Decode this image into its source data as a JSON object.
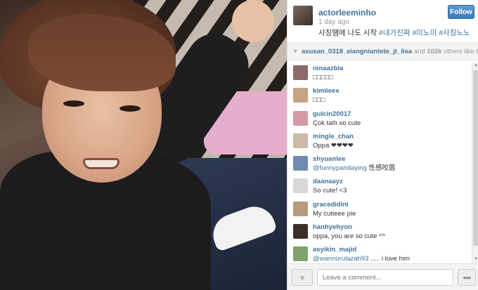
{
  "post": {
    "username": "actorleeminho",
    "time": "1 day ago",
    "caption_text": "사칭땜에 나도 시작 ",
    "caption_tags": [
      "#내가진짜",
      "#미노미",
      "#사칭노노"
    ],
    "follow_label": "Follow"
  },
  "likes": {
    "likers": [
      "asusan_0318",
      "xiangniantete_jt_lisa"
    ],
    "separator": ",",
    "and_text": "and",
    "count": "102k",
    "suffix": "others like this."
  },
  "comments": [
    {
      "user": "ninaazbia",
      "text": "□□□□□",
      "avatar_color": "#8c6a6a"
    },
    {
      "user": "kimiieex",
      "text": "□□□",
      "avatar_color": "#c4a482"
    },
    {
      "user": "gulcin20017",
      "text": "Çok tatlı so cute",
      "avatar_color": "#d69aa6"
    },
    {
      "user": "mingle_chan",
      "text": "Oppa ❤❤❤❤",
      "avatar_color": "#c9b9a6"
    },
    {
      "user": "shyuanlee",
      "mention": "@funnypandaying",
      "text": " 性感咬唇",
      "avatar_color": "#6f8ab0"
    },
    {
      "user": "daanaayz",
      "text": "So cute! <3",
      "avatar_color": "#d8d8d8"
    },
    {
      "user": "gracedidini",
      "text": "My cutieee pie",
      "avatar_color": "#b89a7d"
    },
    {
      "user": "hanhyehyon",
      "text": "oppa, you are so cute ^^",
      "avatar_color": "#3a2f2a"
    },
    {
      "user": "asyikin_majid",
      "mention": "@wannurulazah93",
      "text": " ..... i love him",
      "avatar_color": "#7fa36c"
    }
  ],
  "footer": {
    "comment_placeholder": "Leave a comment...",
    "more_label": "•••"
  }
}
